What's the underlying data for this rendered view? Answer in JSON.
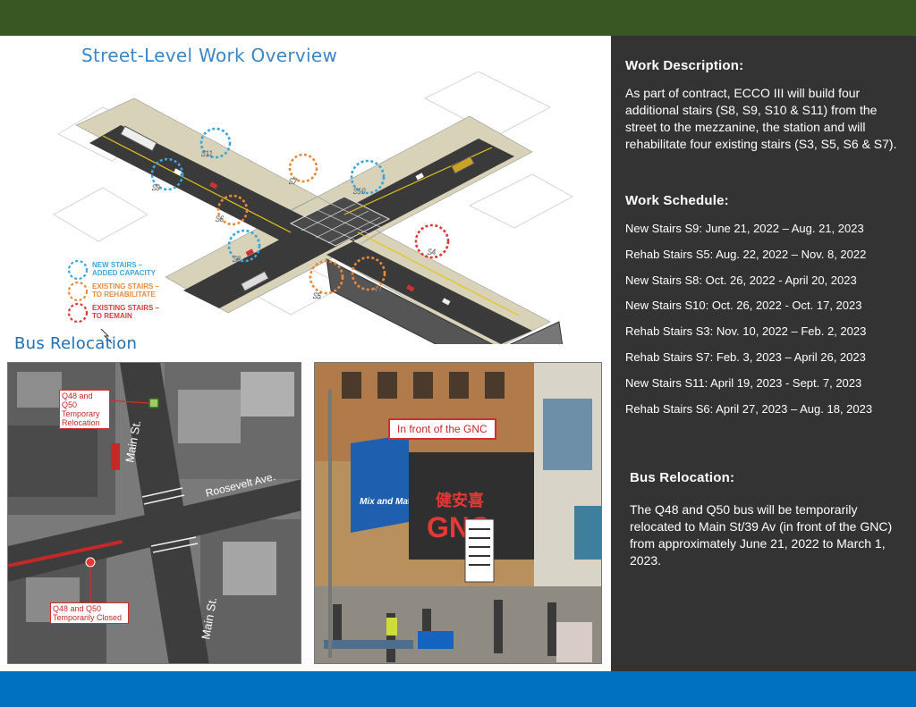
{
  "overview": {
    "title": "Street-Level Work Overview",
    "stair_labels": [
      "S11",
      "S9",
      "S7",
      "S10",
      "S6",
      "S8",
      "S4",
      "S5",
      "S3"
    ],
    "legend": {
      "new": "NEW STAIRS –\nADDED CAPACITY",
      "rehab": "EXISTING STAIRS –\nTO REHABILITATE",
      "remain": "EXISTING STAIRS –\nTO REMAIN"
    },
    "colors": {
      "new": "#3ba6dc",
      "rehab": "#e88a3c",
      "remain": "#d93a3a"
    }
  },
  "bus_section": {
    "title": "Bus Relocation",
    "aerial": {
      "callout_relocation": "Q48 and Q50\nTemporary\nRelocation",
      "callout_closed": "Q48 and Q50\nTemporarily Closed",
      "street_main_1": "Main St.",
      "street_main_2": "Main St.",
      "street_roosevelt": "Roosevelt Ave."
    },
    "storefront": {
      "callout": "In front of the GNC",
      "sign_left": "Mix and Match",
      "sign_right": "GNC"
    }
  },
  "right": {
    "work_description_heading": "Work Description:",
    "work_description_text": "As part of contract, ECCO III will build four additional stairs (S8, S9, S10 & S11) from the street to the mezzanine, the station and will rehabilitate four existing stairs (S3, S5, S6 & S7).",
    "work_schedule_heading": "Work Schedule:",
    "schedule": [
      "New Stairs S9: June 21, 2022 – Aug. 21, 2023",
      "Rehab Stairs S5: Aug. 22, 2022 – Nov. 8, 2022",
      "New Stairs S8: Oct. 26, 2022 - April 20, 2023",
      "New Stairs S10: Oct. 26, 2022 - Oct. 17, 2023",
      "Rehab Stairs S3: Nov. 10, 2022 – Feb. 2, 2023",
      "Rehab Stairs S7: Feb. 3, 2023 – April 26, 2023",
      "New Stairs S11: April 19, 2023 - Sept. 7, 2023",
      "Rehab Stairs S6: April 27, 2023 – Aug. 18, 2023"
    ],
    "bus_relocation_heading": "Bus Relocation:",
    "bus_relocation_text": "The Q48 and Q50 bus will be temporarily relocated to Main St/39 Av (in front of the GNC) from approximately June 21, 2022 to March 1, 2023."
  }
}
